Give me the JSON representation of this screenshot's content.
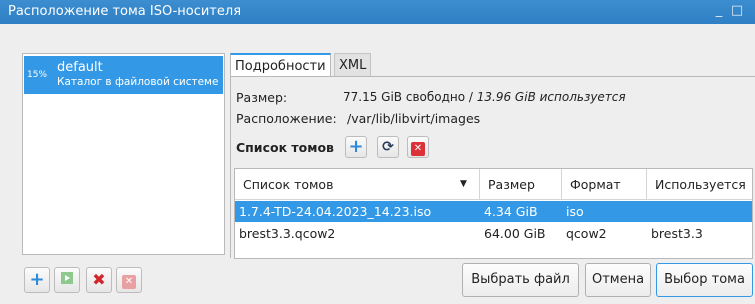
{
  "window": {
    "title": "Расположение тома ISO-носителя",
    "minimize_glyph": "_",
    "maximize_glyph": "□"
  },
  "pools": [
    {
      "usage": "15%",
      "name": "default",
      "description": "Каталог в файловой системе",
      "selected": true
    }
  ],
  "tabs": [
    {
      "label": "Подробности",
      "active": true
    },
    {
      "label": "XML",
      "active": false
    }
  ],
  "details": {
    "size_label": "Размер:",
    "free_text": "77.15 GiB свободно / ",
    "used_text": "13.96 GiB используется",
    "location_label": "Расположение:",
    "location_value": "/var/lib/libvirt/images",
    "volumes_label": "Список томов"
  },
  "volume_toolbar": {
    "add_icon": "plus-icon",
    "refresh_icon": "refresh-icon",
    "delete_icon": "delete-icon"
  },
  "volume_table": {
    "columns": [
      "Список томов",
      "Размер",
      "Формат",
      "Используется"
    ],
    "rows": [
      {
        "name": "1.7.4-TD-24.04.2023_14.23.iso",
        "size": "4.34 GiB",
        "format": "iso",
        "used_by": "",
        "selected": true
      },
      {
        "name": "brest3.3.qcow2",
        "size": "64.00 GiB",
        "format": "qcow2",
        "used_by": "brest3.3",
        "selected": false
      }
    ]
  },
  "pool_toolbar": {
    "add_icon": "plus-icon",
    "start_icon": "play-icon",
    "stop_icon": "stop-icon",
    "delete_icon": "delete-icon"
  },
  "buttons": {
    "browse_local": "Выбрать файл",
    "cancel": "Отмена",
    "choose_volume": "Выбор тома"
  },
  "colors": {
    "titlebar": "#3388cc",
    "selection": "#3399e6",
    "delete": "#dc3136"
  }
}
